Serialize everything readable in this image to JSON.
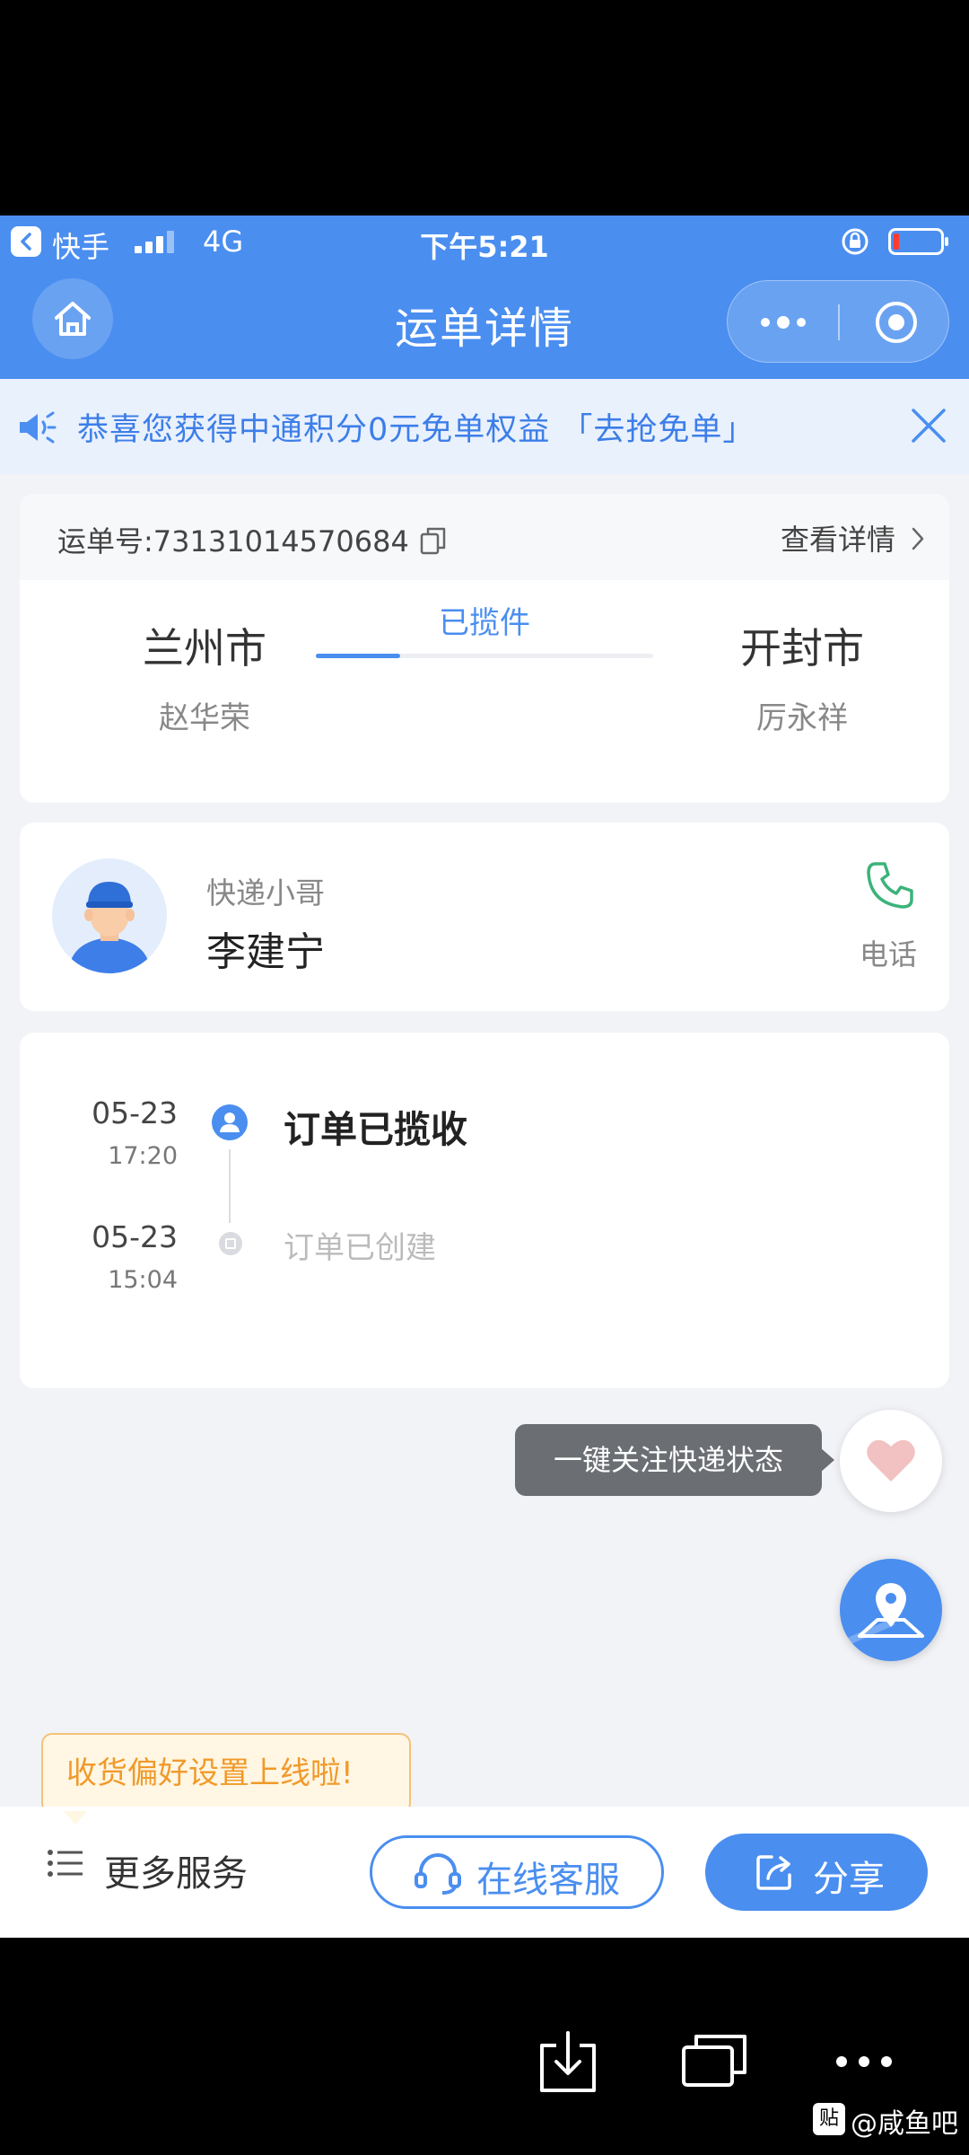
{
  "status_bar": {
    "app_name": "快手",
    "network": "4G",
    "time": "下午5:21"
  },
  "nav": {
    "title": "运单详情"
  },
  "notice": {
    "text": "恭喜您获得中通积分0元免单权益 「去抢免单」"
  },
  "waybill": {
    "number_label": "运单号:73131014570684",
    "detail_link": "查看详情",
    "from_city": "兰州市",
    "from_person": "赵华荣",
    "status": "已揽件",
    "progress": 0.25,
    "to_city": "开封市",
    "to_person": "厉永祥"
  },
  "courier": {
    "role": "快递小哥",
    "name": "李建宁",
    "phone_label": "电话"
  },
  "timeline": [
    {
      "date": "05-23",
      "time": "17:20",
      "event": "订单已揽收"
    },
    {
      "date": "05-23",
      "time": "15:04",
      "event": "订单已创建"
    }
  ],
  "follow_tip": "一键关注快递状态",
  "pref_tip": "收货偏好设置上线啦!",
  "bottom_bar": {
    "more_services": "更多服务",
    "online_service": "在线客服",
    "share": "分享"
  },
  "watermark": {
    "badge": "贴",
    "text": "@咸鱼吧"
  },
  "colors": {
    "primary": "#4a8ef0",
    "notice_bg": "#e9f1fd",
    "tip_orange": "#f09a2a"
  }
}
